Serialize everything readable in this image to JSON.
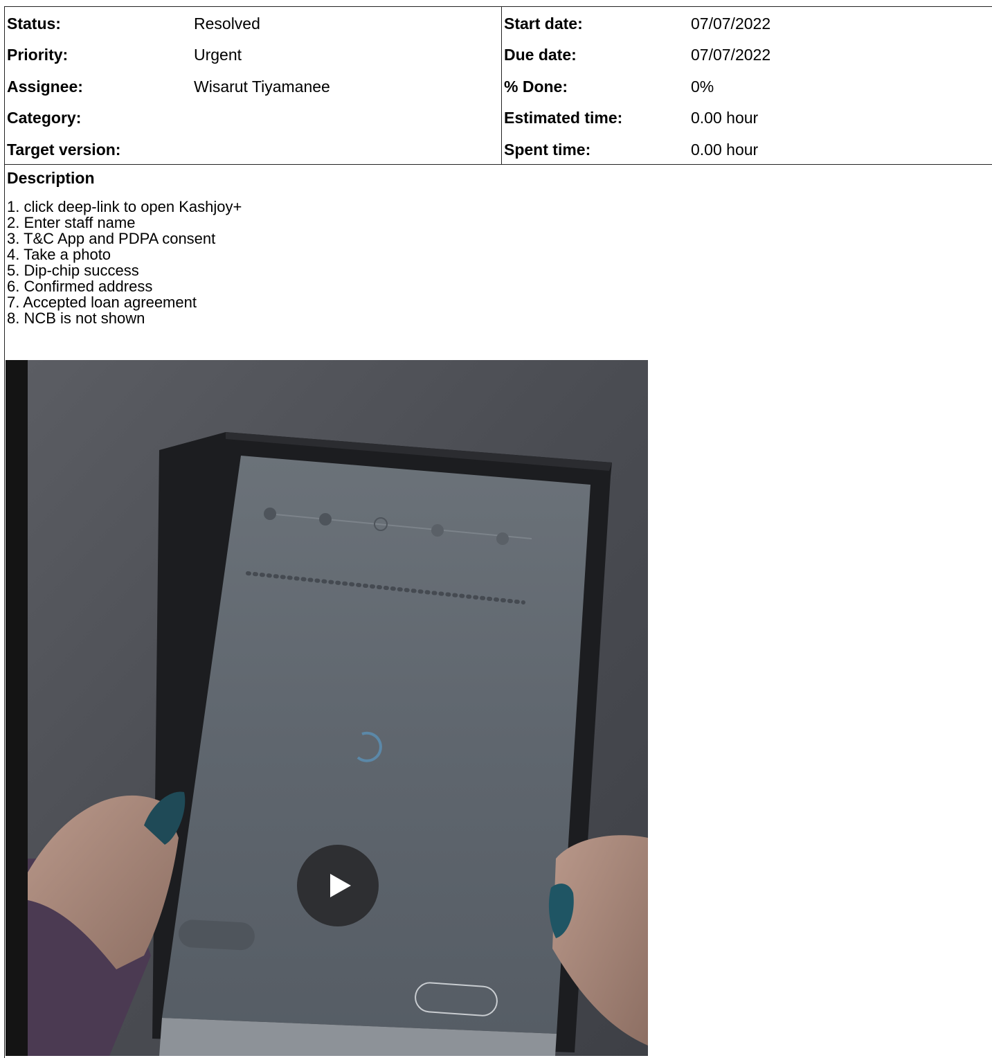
{
  "attributes": {
    "left": [
      {
        "label": "Status:",
        "value": "Resolved"
      },
      {
        "label": "Priority:",
        "value": "Urgent"
      },
      {
        "label": "Assignee:",
        "value": "Wisarut Tiyamanee"
      },
      {
        "label": "Category:",
        "value": ""
      },
      {
        "label": "Target version:",
        "value": ""
      }
    ],
    "right": [
      {
        "label": "Start date:",
        "value": "07/07/2022"
      },
      {
        "label": "Due date:",
        "value": "07/07/2022"
      },
      {
        "label": "% Done:",
        "value": "0%"
      },
      {
        "label": "Estimated time:",
        "value": "0.00 hour"
      },
      {
        "label": "Spent time:",
        "value": "0.00 hour"
      }
    ]
  },
  "description": {
    "heading": "Description",
    "steps": [
      "1. click deep-link to open Kashjoy+",
      "2. Enter staff name",
      "3. T&C App  and PDPA consent",
      "4. Take a photo",
      "5. Dip-chip success",
      "6. Confirmed address",
      "7. Accepted loan agreement",
      "8. NCB is not shown"
    ]
  },
  "video": {
    "play_icon": "play-icon"
  }
}
